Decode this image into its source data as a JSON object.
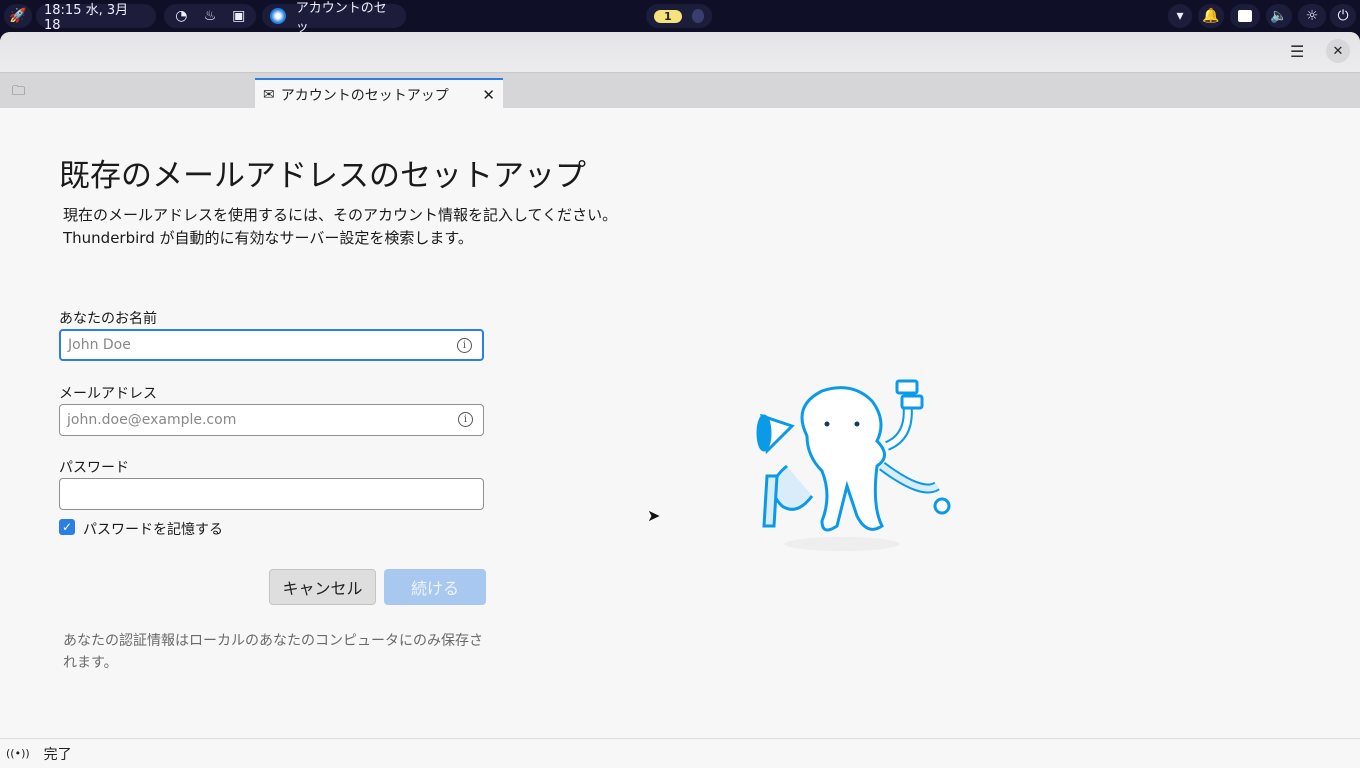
{
  "topbar": {
    "datetime": "18:15 水, 3月 18",
    "active_window": "アカウントのセッ",
    "workspace": "1"
  },
  "tab": {
    "title": "アカウントのセットアップ"
  },
  "page": {
    "title": "既存のメールアドレスのセットアップ",
    "desc1": "現在のメールアドレスを使用するには、そのアカウント情報を記入してください。",
    "desc2": "Thunderbird が自動的に有効なサーバー設定を検索します。"
  },
  "form": {
    "name_label": "あなたのお名前",
    "name_placeholder": "John Doe",
    "email_label": "メールアドレス",
    "email_placeholder": "john.doe@example.com",
    "password_label": "パスワード",
    "remember_label": "パスワードを記憶する",
    "remember_checked": true,
    "cancel": "キャンセル",
    "continue": "続ける",
    "note": "あなたの認証情報はローカルのあなたのコンピュータにのみ保存されます。"
  },
  "status": {
    "text": "完了"
  },
  "colors": {
    "accent": "#2a7ee6",
    "disabled": "#a8c8f0"
  }
}
